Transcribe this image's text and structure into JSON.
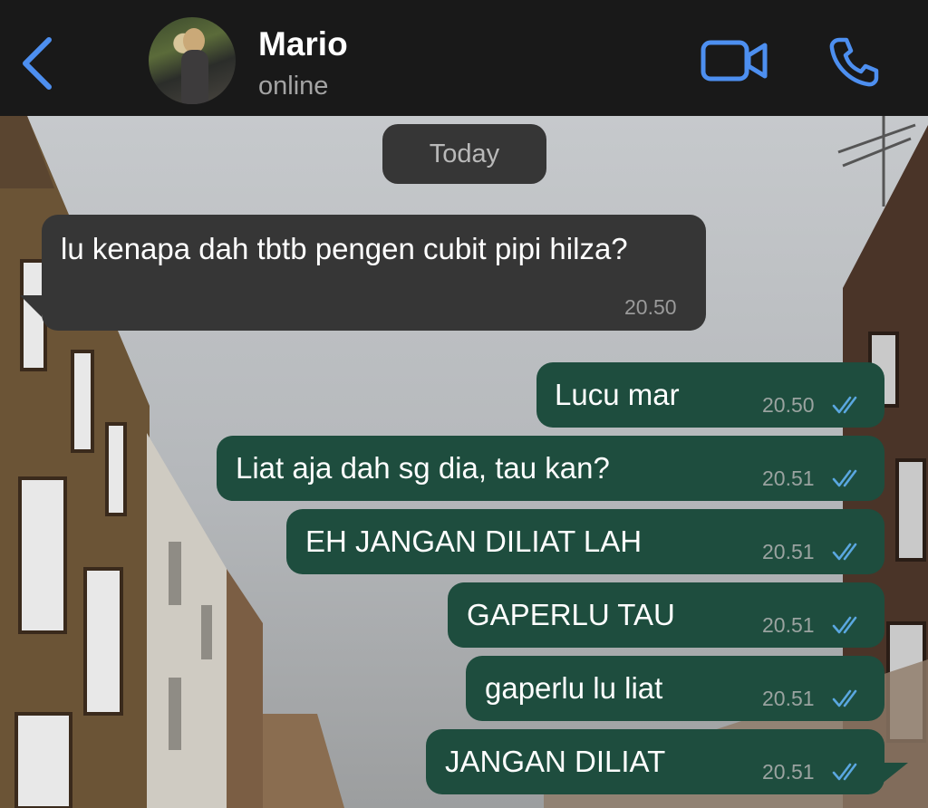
{
  "header": {
    "contact_name": "Mario",
    "contact_status": "online",
    "icons": [
      "chevron-left-icon",
      "video-camera-icon",
      "phone-icon"
    ],
    "accent_color": "#4d8ff0"
  },
  "chat": {
    "date_separator": "Today",
    "messages": [
      {
        "direction": "incoming",
        "text": "lu kenapa dah tbtb pengen cubit pipi hilza?",
        "time": "20.50"
      },
      {
        "direction": "outgoing",
        "text": "Lucu mar",
        "time": "20.50",
        "status": "read"
      },
      {
        "direction": "outgoing",
        "text": "Liat aja dah sg dia, tau kan?",
        "time": "20.51",
        "status": "read"
      },
      {
        "direction": "outgoing",
        "text": "EH JANGAN DILIAT LAH",
        "time": "20.51",
        "status": "read"
      },
      {
        "direction": "outgoing",
        "text": "GAPERLU TAU",
        "time": "20.51",
        "status": "read"
      },
      {
        "direction": "outgoing",
        "text": "gaperlu lu liat",
        "time": "20.51",
        "status": "read"
      },
      {
        "direction": "outgoing",
        "text": "JANGAN DILIAT",
        "time": "20.51",
        "status": "read"
      }
    ]
  },
  "colors": {
    "incoming_bubble": "#363636",
    "outgoing_bubble": "#1e4d3e",
    "read_ticks": "#5aa7e0"
  }
}
